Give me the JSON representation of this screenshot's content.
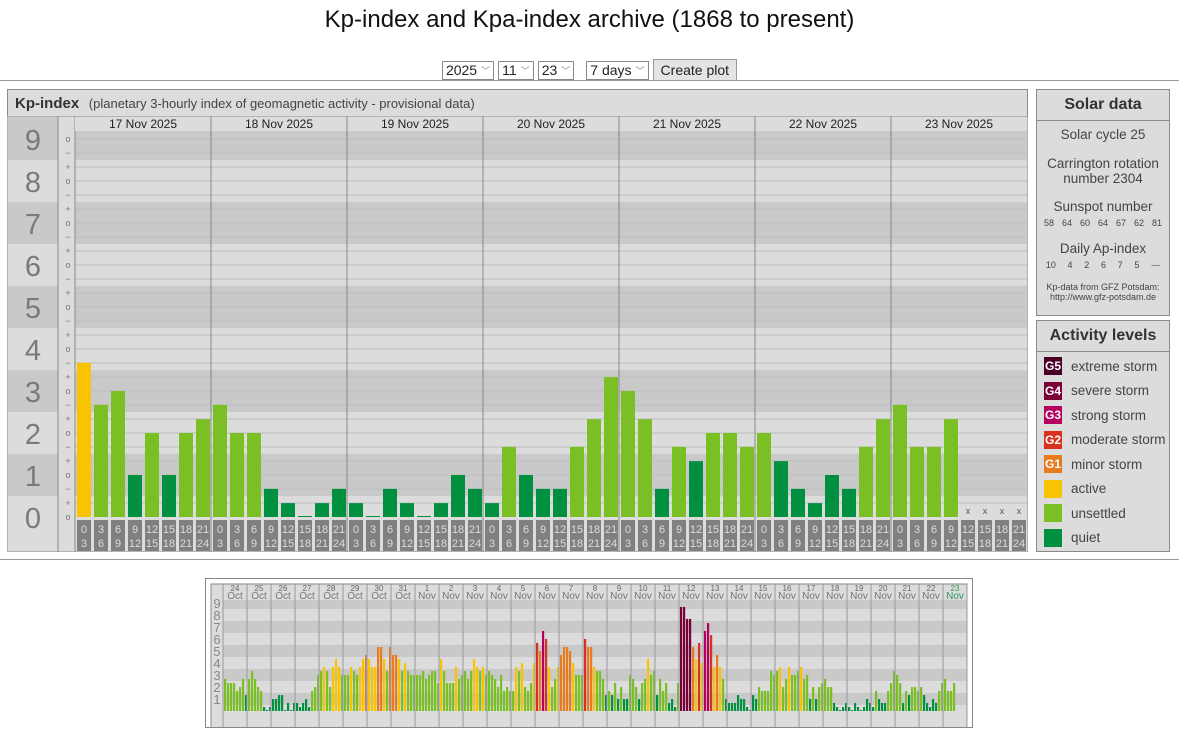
{
  "title": "Kp-index and Kpa-index archive (1868 to present)",
  "controls": {
    "year": "2025",
    "month": "11",
    "day": "23",
    "range": "7 days",
    "create_label": "Create plot"
  },
  "kp_panel": {
    "title": "Kp-index",
    "subtitle": "(planetary 3-hourly index of geomagnetic activity - provisional data)"
  },
  "colors": {
    "quiet": "#009040",
    "unsettled": "#7abf23",
    "active": "#f8c300",
    "G1": "#e87b1e",
    "G2": "#d93020",
    "G3": "#b5005e",
    "G4": "#7a003a",
    "G5": "#4a0026"
  },
  "chart_data": [
    {
      "type": "bar",
      "title": "Kp-index",
      "ylim": [
        0,
        9
      ],
      "y_major_labels": [
        "0",
        "1",
        "2",
        "3",
        "4",
        "5",
        "6",
        "7",
        "8",
        "9"
      ],
      "y_minor_labels": {
        "plus": "+",
        "zero": "o",
        "minus": "−"
      },
      "missing_marker": "x",
      "hour_labels": [
        [
          "0",
          "3"
        ],
        [
          "3",
          "6"
        ],
        [
          "6",
          "9"
        ],
        [
          "9",
          "12"
        ],
        [
          "12",
          "15"
        ],
        [
          "15",
          "18"
        ],
        [
          "18",
          "21"
        ],
        [
          "21",
          "24"
        ]
      ],
      "days": [
        {
          "label": "17 Nov 2025",
          "values": [
            3.67,
            2.67,
            3.0,
            1.0,
            2.0,
            1.0,
            2.0,
            2.33
          ]
        },
        {
          "label": "18 Nov 2025",
          "values": [
            2.67,
            2.0,
            2.0,
            0.67,
            0.33,
            0.0,
            0.33,
            0.67
          ]
        },
        {
          "label": "19 Nov 2025",
          "values": [
            0.33,
            0.0,
            0.67,
            0.33,
            0.0,
            0.33,
            1.0,
            0.67
          ]
        },
        {
          "label": "20 Nov 2025",
          "values": [
            0.33,
            1.67,
            1.0,
            0.67,
            0.67,
            1.67,
            2.33,
            3.33
          ]
        },
        {
          "label": "21 Nov 2025",
          "values": [
            3.0,
            2.33,
            0.67,
            1.67,
            1.33,
            2.0,
            2.0,
            1.67
          ]
        },
        {
          "label": "22 Nov 2025",
          "values": [
            2.0,
            1.33,
            0.67,
            0.33,
            1.0,
            0.67,
            1.67,
            2.33
          ]
        },
        {
          "label": "23 Nov 2025",
          "values": [
            2.67,
            1.67,
            1.67,
            2.33,
            null,
            null,
            null,
            null
          ]
        }
      ]
    },
    {
      "type": "bar",
      "title": "Kp-index last 31 days",
      "ylim": [
        0,
        9
      ],
      "y_labels": [
        "1",
        "2",
        "3",
        "4",
        "5",
        "6",
        "7",
        "8",
        "9"
      ],
      "days": [
        {
          "d": "24",
          "m": "Oct",
          "values": [
            2.67,
            2.33,
            2.33,
            2.33,
            1.67,
            2,
            2.67,
            1.33
          ]
        },
        {
          "d": "25",
          "m": "Oct",
          "values": [
            2.67,
            3.33,
            2.67,
            2,
            1.67,
            0.33,
            0,
            0.33
          ]
        },
        {
          "d": "26",
          "m": "Oct",
          "values": [
            1,
            1,
            1.33,
            1.33,
            0,
            0.67,
            0,
            0.67
          ]
        },
        {
          "d": "27",
          "m": "Oct",
          "values": [
            0.67,
            0.33,
            0.67,
            1,
            0.33,
            1.67,
            2,
            3
          ]
        },
        {
          "d": "28",
          "m": "Oct",
          "values": [
            3.33,
            3.67,
            3.33,
            2,
            3.67,
            4.33,
            3.67,
            3
          ]
        },
        {
          "d": "29",
          "m": "Oct",
          "values": [
            3,
            3,
            3.67,
            3.33,
            3,
            3.67,
            4.33,
            4.67
          ]
        },
        {
          "d": "30",
          "m": "Oct",
          "values": [
            4.33,
            3.67,
            3.67,
            5.33,
            5.33,
            4.33,
            3.33,
            5.33
          ]
        },
        {
          "d": "31",
          "m": "Oct",
          "values": [
            4.67,
            4.67,
            4.33,
            3.33,
            4,
            3.33,
            3,
            3
          ]
        },
        {
          "d": "1",
          "m": "Nov",
          "values": [
            3,
            3,
            3.33,
            2.67,
            3,
            3.33,
            3.33,
            2.33
          ]
        },
        {
          "d": "2",
          "m": "Nov",
          "values": [
            4.33,
            3.33,
            2.33,
            2.33,
            2.33,
            3.67,
            2.67,
            3
          ]
        },
        {
          "d": "3",
          "m": "Nov",
          "values": [
            3.33,
            2.67,
            3.33,
            4.33,
            3.67,
            3.33,
            3.67,
            3
          ]
        },
        {
          "d": "4",
          "m": "Nov",
          "values": [
            3.33,
            3,
            2.67,
            2,
            3,
            1.67,
            2,
            1.67
          ]
        },
        {
          "d": "5",
          "m": "Nov",
          "values": [
            1.67,
            3.67,
            3.33,
            4,
            2,
            1.67,
            2.33,
            4
          ]
        },
        {
          "d": "6",
          "m": "Nov",
          "values": [
            5.67,
            5,
            6.67,
            6,
            3.67,
            2,
            2.67,
            3.67
          ]
        },
        {
          "d": "7",
          "m": "Nov",
          "values": [
            4.67,
            5.33,
            5.33,
            5,
            4,
            3,
            3,
            3
          ]
        },
        {
          "d": "8",
          "m": "Nov",
          "values": [
            6,
            5.33,
            5.33,
            3.67,
            3.33,
            3.33,
            2.67,
            1.33
          ]
        },
        {
          "d": "9",
          "m": "Nov",
          "values": [
            1.67,
            1.33,
            2.33,
            1,
            2,
            1,
            1,
            3
          ]
        },
        {
          "d": "10",
          "m": "Nov",
          "values": [
            2.67,
            2,
            1,
            2.33,
            2.67,
            4.33,
            3,
            3.33
          ]
        },
        {
          "d": "11",
          "m": "Nov",
          "values": [
            1.33,
            2.67,
            1.67,
            2.33,
            0.67,
            1,
            0.33,
            2.33
          ]
        },
        {
          "d": "12",
          "m": "Nov",
          "values": [
            8.67,
            8.67,
            7.67,
            7.67,
            5.33,
            4.33,
            5.67,
            4
          ]
        },
        {
          "d": "13",
          "m": "Nov",
          "values": [
            6.67,
            7.33,
            6.33,
            3.67,
            4.67,
            3.67,
            2.67,
            1
          ]
        },
        {
          "d": "14",
          "m": "Nov",
          "values": [
            0.67,
            0.67,
            0.67,
            1.33,
            1,
            1,
            0.33,
            0
          ]
        },
        {
          "d": "15",
          "m": "Nov",
          "values": [
            1.33,
            1,
            2,
            1.67,
            1.67,
            1.67,
            3.33,
            3
          ]
        },
        {
          "d": "16",
          "m": "Nov",
          "values": [
            3.33,
            3.67,
            2,
            2.67,
            3.67,
            3,
            3,
            3.33
          ]
        },
        {
          "d": "17",
          "m": "Nov",
          "values": [
            3.67,
            2.67,
            3,
            1,
            2,
            1,
            2,
            2.33
          ]
        },
        {
          "d": "18",
          "m": "Nov",
          "values": [
            2.67,
            2,
            2,
            0.67,
            0.33,
            0,
            0.33,
            0.67
          ]
        },
        {
          "d": "19",
          "m": "Nov",
          "values": [
            0.33,
            0,
            0.67,
            0.33,
            0,
            0.33,
            1,
            0.67
          ]
        },
        {
          "d": "20",
          "m": "Nov",
          "values": [
            0.33,
            1.67,
            1,
            0.67,
            0.67,
            1.67,
            2.33,
            3.33
          ]
        },
        {
          "d": "21",
          "m": "Nov",
          "values": [
            3,
            2.33,
            0.67,
            1.67,
            1.33,
            2,
            2,
            1.67
          ]
        },
        {
          "d": "22",
          "m": "Nov",
          "values": [
            2,
            1.33,
            0.67,
            0.33,
            1,
            0.67,
            1.67,
            2.33
          ]
        },
        {
          "d": "23",
          "m": "Nov",
          "values": [
            2.67,
            1.67,
            1.67,
            2.33,
            null,
            null,
            null,
            null
          ]
        }
      ]
    }
  ],
  "solar": {
    "title": "Solar data",
    "cycle": "Solar cycle 25",
    "carrington_1": "Carrington rotation",
    "carrington_2": "number 2304",
    "sunspot_title": "Sunspot number",
    "sunspots": [
      "58",
      "64",
      "60",
      "64",
      "67",
      "62",
      "81"
    ],
    "ap_title": "Daily Ap-index",
    "ap": [
      "10",
      "4",
      "2",
      "6",
      "7",
      "5",
      "---"
    ],
    "source_1": "Kp-data from GFZ Potsdam:",
    "source_2": "http://www.gfz-potsdam.de"
  },
  "activity": {
    "title": "Activity levels",
    "levels": [
      {
        "badge": "G5",
        "label": "extreme storm",
        "color": "#4a0026"
      },
      {
        "badge": "G4",
        "label": "severe storm",
        "color": "#7a003a"
      },
      {
        "badge": "G3",
        "label": "strong storm",
        "color": "#b5005e"
      },
      {
        "badge": "G2",
        "label": "moderate storm",
        "color": "#d93020"
      },
      {
        "badge": "G1",
        "label": "minor storm",
        "color": "#e87b1e"
      },
      {
        "badge": "",
        "label": "active",
        "color": "#f8c300"
      },
      {
        "badge": "",
        "label": "unsettled",
        "color": "#7abf23"
      },
      {
        "badge": "",
        "label": "quiet",
        "color": "#009040"
      }
    ]
  }
}
